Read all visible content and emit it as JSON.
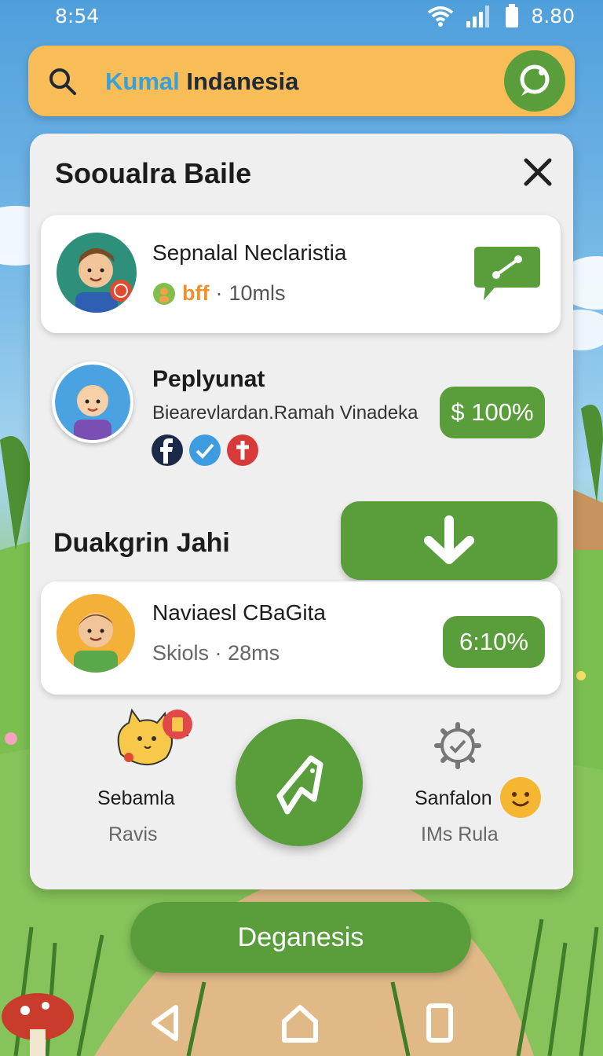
{
  "status_bar": {
    "time": "8:54",
    "battery_text": "8.80"
  },
  "search": {
    "query_part1": "Kumal",
    "query_part2": "Indanesia"
  },
  "panel": {
    "title": "Sooualra Baile"
  },
  "contacts": [
    {
      "name": "Sepnalal Neclaristia",
      "tag": "bff",
      "separator": "·",
      "time": "10mls"
    },
    {
      "name": "Peplyunat",
      "subtitle": "Biearevlardan.Ramah Vinadeka",
      "badge": "$ 100%"
    }
  ],
  "section": {
    "title": "Duakgrin Jahi"
  },
  "highlight_contact": {
    "name": "Naviaesl CBaGita",
    "detail": "Skiols",
    "separator": "·",
    "time": "28ms",
    "badge": "6:10%"
  },
  "actions": {
    "left": {
      "label": "Sebamla",
      "sub": "Ravis"
    },
    "right": {
      "label": "Sanfalon",
      "sub": "IMs Rula"
    }
  },
  "bottom_button": {
    "label": "Deganesis"
  },
  "colors": {
    "accent_green": "#5a9e3c",
    "search_bg": "#f8bd57",
    "panel_bg": "#efefef",
    "tag_orange": "#f0902a"
  }
}
